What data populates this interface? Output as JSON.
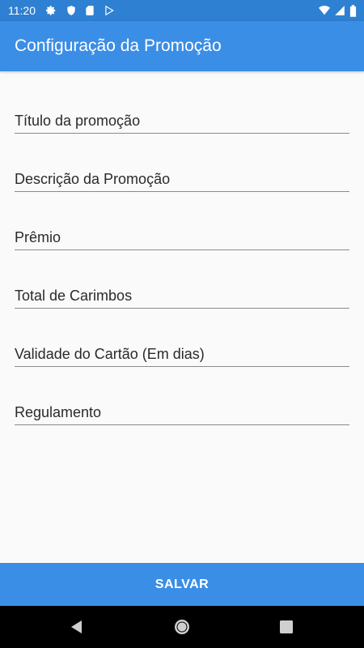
{
  "status_bar": {
    "time": "11:20",
    "icons_left": [
      "gear-icon",
      "shield-icon",
      "sd-card-icon",
      "play-store-icon"
    ],
    "icons_right": [
      "wifi-icon",
      "cell-signal-icon",
      "battery-icon"
    ]
  },
  "app_bar": {
    "title": "Configuração da Promoção",
    "color": "#3a8ee6"
  },
  "form": {
    "fields": [
      {
        "label": "Título da promoção"
      },
      {
        "label": "Descrição da Promoção"
      },
      {
        "label": "Prêmio"
      },
      {
        "label": "Total de Carimbos"
      },
      {
        "label": "Validade do Cartão (Em dias)"
      },
      {
        "label": "Regulamento"
      }
    ]
  },
  "save_button": {
    "label": "SALVAR"
  },
  "nav_bar": {
    "buttons": [
      "back-icon",
      "home-icon",
      "recents-icon"
    ]
  }
}
